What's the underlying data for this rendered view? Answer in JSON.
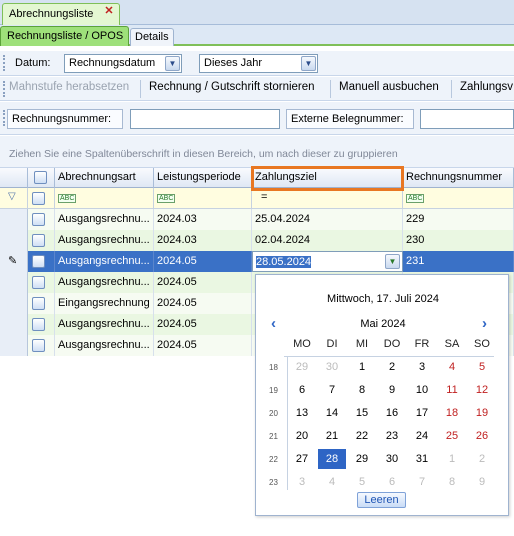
{
  "doc_tab": {
    "label": "Abrechnungsliste",
    "close_glyph": "✕"
  },
  "sub_tabs": [
    {
      "label": "Rechnungsliste / OPOS"
    },
    {
      "label": "Details"
    }
  ],
  "filter_bar": {
    "datum_label": "Datum:",
    "date_field": "Rechnungsdatum",
    "period": "Dieses Jahr"
  },
  "actions": {
    "mahnstufe": "Mahnstufe herabsetzen",
    "storno": "Rechnung / Gutschrift stornieren",
    "manuell": "Manuell ausbuchen",
    "zahlung": "Zahlungsv"
  },
  "search": {
    "rechnungsnummer_label": "Rechnungsnummer:",
    "rechnungsnummer_value": "",
    "extern_label": "Externe Belegnummer:",
    "extern_value": ""
  },
  "group_panel_hint": "Ziehen Sie eine Spaltenüberschrift in diesen Bereich, um nach dieser zu gruppieren",
  "grid": {
    "columns": [
      "Abrechnungsart",
      "Leistungsperiode",
      "Zahlungsziel",
      "Rechnungsnummer"
    ],
    "filter_date_op": "=",
    "rows": [
      {
        "art": "Ausgangsrechnu...",
        "periode": "2024.03",
        "ziel": "25.04.2024",
        "nummer": "229"
      },
      {
        "art": "Ausgangsrechnu...",
        "periode": "2024.03",
        "ziel": "02.04.2024",
        "nummer": "230"
      },
      {
        "art": "Ausgangsrechnu...",
        "periode": "2024.05",
        "ziel": "28.05.2024",
        "nummer": "231"
      },
      {
        "art": "Ausgangsrechnu...",
        "periode": "2024.05",
        "ziel": "",
        "nummer": ""
      },
      {
        "art": "Eingangsrechnung",
        "periode": "2024.05",
        "ziel": "",
        "nummer": ""
      },
      {
        "art": "Ausgangsrechnu...",
        "periode": "2024.05",
        "ziel": "",
        "nummer": ""
      },
      {
        "art": "Ausgangsrechnu...",
        "periode": "2024.05",
        "ziel": "",
        "nummer": ""
      }
    ]
  },
  "calendar": {
    "today_label": "Mittwoch, 17. Juli 2024",
    "month_label": "Mai 2024",
    "prev_glyph": "‹",
    "next_glyph": "›",
    "weekdays": [
      "MO",
      "DI",
      "MI",
      "DO",
      "FR",
      "SA",
      "SO"
    ],
    "weeks": [
      {
        "wk": "18",
        "days": [
          "29",
          "30",
          "1",
          "2",
          "3",
          "4",
          "5"
        ]
      },
      {
        "wk": "19",
        "days": [
          "6",
          "7",
          "8",
          "9",
          "10",
          "11",
          "12"
        ]
      },
      {
        "wk": "20",
        "days": [
          "13",
          "14",
          "15",
          "16",
          "17",
          "18",
          "19"
        ]
      },
      {
        "wk": "21",
        "days": [
          "20",
          "21",
          "22",
          "23",
          "24",
          "25",
          "26"
        ]
      },
      {
        "wk": "22",
        "days": [
          "27",
          "28",
          "29",
          "30",
          "31",
          "1",
          "2"
        ]
      },
      {
        "wk": "23",
        "days": [
          "3",
          "4",
          "5",
          "6",
          "7",
          "8",
          "9"
        ]
      }
    ],
    "selected_day": "28",
    "clear_label": "Leeren"
  },
  "colors": {
    "selection": "#3a71c6",
    "highlight": "#e87722",
    "tab_green": "#9ee07a"
  }
}
